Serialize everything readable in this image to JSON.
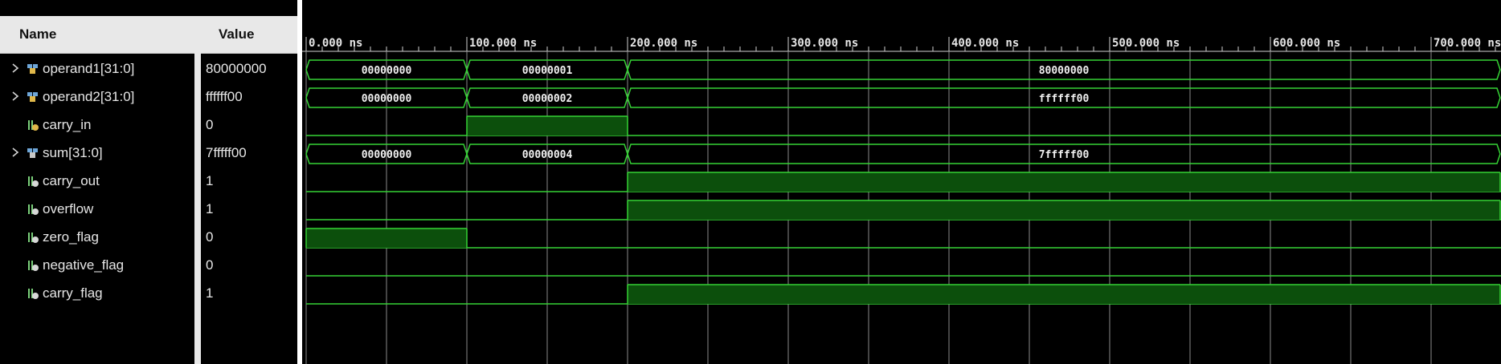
{
  "columns": {
    "name": "Name",
    "value": "Value"
  },
  "timeline": {
    "ticks": [
      {
        "t": 0,
        "label": "0.000 ns"
      },
      {
        "t": 100,
        "label": "100.000 ns"
      },
      {
        "t": 200,
        "label": "200.000 ns"
      },
      {
        "t": 300,
        "label": "300.000 ns"
      },
      {
        "t": 400,
        "label": "400.000 ns"
      },
      {
        "t": 500,
        "label": "500.000 ns"
      },
      {
        "t": 600,
        "label": "600.000 ns"
      },
      {
        "t": 700,
        "label": "700.000 ns"
      }
    ],
    "window_end_ns": 743
  },
  "signals": [
    {
      "name": "operand1[31:0]",
      "value": "80000000",
      "type": "bus",
      "icon": "bus-input-icon",
      "expandable": true,
      "segments": [
        {
          "t0": 0,
          "t1": 100,
          "label": "00000000"
        },
        {
          "t0": 100,
          "t1": 200,
          "label": "00000001"
        },
        {
          "t0": 200,
          "t1": 743,
          "label": "80000000"
        }
      ]
    },
    {
      "name": "operand2[31:0]",
      "value": "ffffff00",
      "type": "bus",
      "icon": "bus-input-icon",
      "expandable": true,
      "segments": [
        {
          "t0": 0,
          "t1": 100,
          "label": "00000000"
        },
        {
          "t0": 100,
          "t1": 200,
          "label": "00000002"
        },
        {
          "t0": 200,
          "t1": 743,
          "label": "ffffff00"
        }
      ]
    },
    {
      "name": "carry_in",
      "value": "0",
      "type": "bit",
      "icon": "bit-input-icon",
      "expandable": false,
      "high": [
        [
          100,
          200
        ]
      ]
    },
    {
      "name": "sum[31:0]",
      "value": "7fffff00",
      "type": "bus",
      "icon": "bus-output-icon",
      "expandable": true,
      "segments": [
        {
          "t0": 0,
          "t1": 100,
          "label": "00000000"
        },
        {
          "t0": 100,
          "t1": 200,
          "label": "00000004"
        },
        {
          "t0": 200,
          "t1": 743,
          "label": "7fffff00"
        }
      ]
    },
    {
      "name": "carry_out",
      "value": "1",
      "type": "bit",
      "icon": "bit-output-icon",
      "expandable": false,
      "high": [
        [
          200,
          743
        ]
      ]
    },
    {
      "name": "overflow",
      "value": "1",
      "type": "bit",
      "icon": "bit-output-icon",
      "expandable": false,
      "high": [
        [
          200,
          743
        ]
      ]
    },
    {
      "name": "zero_flag",
      "value": "0",
      "type": "bit",
      "icon": "bit-output-icon",
      "expandable": false,
      "high": [
        [
          0,
          100
        ]
      ]
    },
    {
      "name": "negative_flag",
      "value": "0",
      "type": "bit",
      "icon": "bit-output-icon",
      "expandable": false,
      "high": []
    },
    {
      "name": "carry_flag",
      "value": "1",
      "type": "bit",
      "icon": "bit-output-icon",
      "expandable": false,
      "high": [
        [
          200,
          743
        ]
      ]
    }
  ],
  "colors": {
    "trace": "#35d335",
    "fill": "#0c4f0c",
    "grid": "#8a8a8a",
    "text": "#e6e6e6",
    "background": "#000000"
  }
}
